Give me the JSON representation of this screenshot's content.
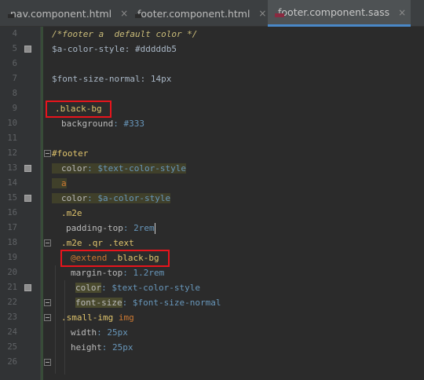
{
  "tabs": [
    {
      "name": "nav.component.html",
      "icon": "html-file-icon",
      "active": false
    },
    {
      "name": "footer.component.html",
      "icon": "html-file-icon",
      "active": false
    },
    {
      "name": "footer.component.sass",
      "icon": "sass-file-icon",
      "active": true
    }
  ],
  "close_glyph": "×",
  "line_numbers": [
    "4",
    "5",
    "6",
    "7",
    "8",
    "9",
    "10",
    "11",
    "12",
    "13",
    "14",
    "15",
    "16",
    "17",
    "18",
    "19",
    "20",
    "21",
    "22",
    "23",
    "24",
    "25",
    "26"
  ],
  "code": {
    "l4": "/*footer a  default color */",
    "l5_var": "$a-color-style",
    "l5_val": ": #dddddb5",
    "l7_var": "$font-size-normal",
    "l7_val": ": 14px",
    "l9": ".black-bg",
    "l10_prop": "background",
    "l10_val": ": #333",
    "l12": "#footer",
    "l13_prop": "color",
    "l13_val": ": $text-color-style",
    "l14": "a",
    "l15_prop": "color",
    "l15_val": ": $a-color-style",
    "l16": ".m2e",
    "l17_prop": "padding-top",
    "l17_val": ": 2rem",
    "l18": ".m2e .qr .text",
    "l19_kw": "@extend",
    "l19_sel": " .black-bg",
    "l20_prop": "margin-top",
    "l20_val": ": 1.2rem",
    "l21_prop": "color",
    "l21_val": ": $text-color-style",
    "l22_prop": "font-size",
    "l22_val": ": $font-size-normal",
    "l23_sel": ".small-img",
    "l23_tag": " img",
    "l24_prop": "width",
    "l24_val": ": 25px",
    "l25_prop": "height",
    "l25_val": ": 25px"
  },
  "colors": {
    "background": "#2b2b2b",
    "highlight_box": "#e8141c",
    "active_tab_underline": "#4a88c7"
  }
}
